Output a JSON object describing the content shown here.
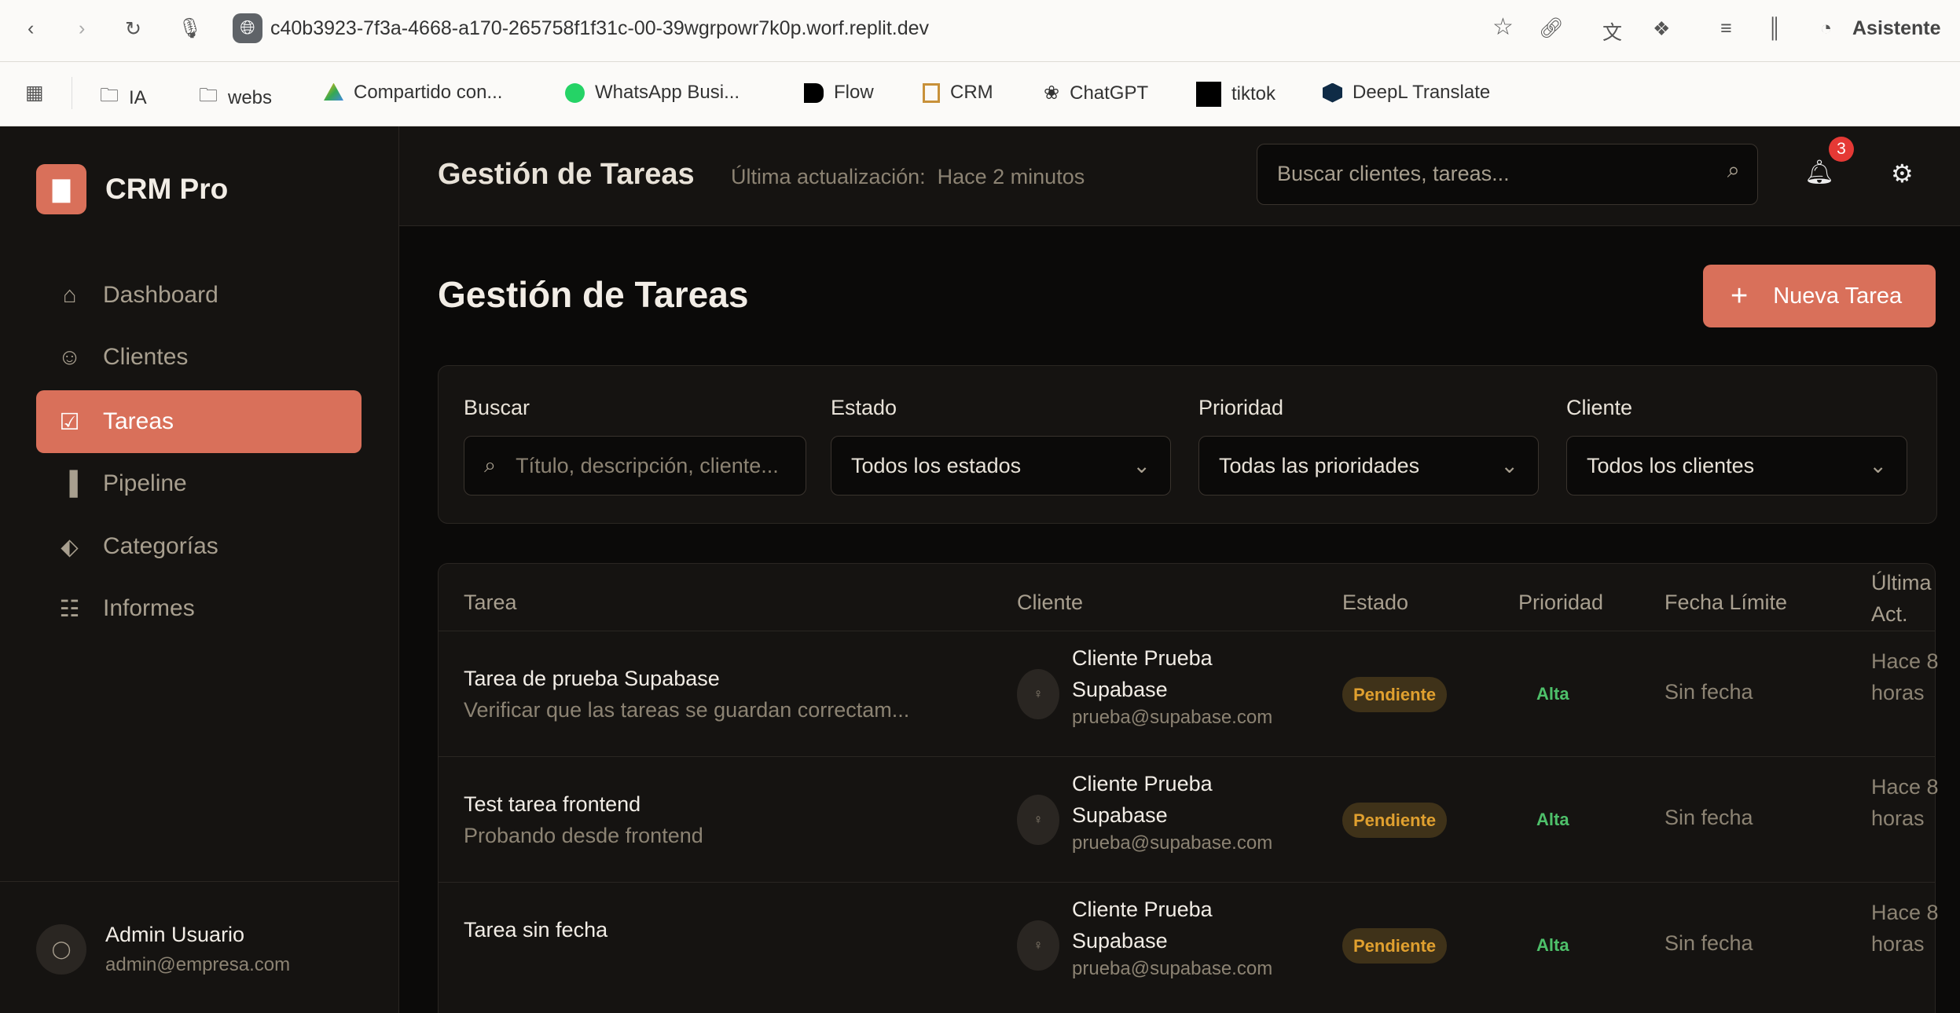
{
  "browser": {
    "url": "c40b3923-7f3a-4668-a170-265758f1f31c-00-39wgrpowr7k0p.worf.replit.dev",
    "assistant_label": "Asistente",
    "bookmarks": [
      {
        "label": "IA",
        "icon": "folder-icon"
      },
      {
        "label": "webs",
        "icon": "folder-icon"
      },
      {
        "label": "Compartido con...",
        "icon": "google-drive-icon"
      },
      {
        "label": "WhatsApp Busi...",
        "icon": "whatsapp-icon"
      },
      {
        "label": "Flow",
        "icon": "flow-icon"
      },
      {
        "label": "CRM",
        "icon": "calendar-icon"
      },
      {
        "label": "ChatGPT",
        "icon": "chatgpt-icon"
      },
      {
        "label": "tiktok",
        "icon": "tiktok-icon"
      },
      {
        "label": "DeepL Translate",
        "icon": "deepl-icon"
      }
    ]
  },
  "sidebar": {
    "brand": "CRM Pro",
    "items": [
      {
        "label": "Dashboard",
        "icon": "home-icon"
      },
      {
        "label": "Clientes",
        "icon": "users-icon"
      },
      {
        "label": "Tareas",
        "icon": "check-square-icon",
        "active": true
      },
      {
        "label": "Pipeline",
        "icon": "bar-chart-icon"
      },
      {
        "label": "Categorías",
        "icon": "tags-icon"
      },
      {
        "label": "Informes",
        "icon": "report-icon"
      }
    ],
    "user": {
      "name": "Admin Usuario",
      "email": "admin@empresa.com"
    }
  },
  "header": {
    "title": "Gestión de Tareas",
    "updated_label": "Última actualización:",
    "updated_value": "Hace 2 minutos",
    "search_placeholder": "Buscar clientes, tareas...",
    "notifications": "3"
  },
  "page": {
    "title": "Gestión de Tareas",
    "new_button": "Nueva Tarea"
  },
  "filters": {
    "search_label": "Buscar",
    "search_placeholder": "Título, descripción, cliente...",
    "estado_label": "Estado",
    "estado_value": "Todos los estados",
    "prioridad_label": "Prioridad",
    "prioridad_value": "Todas las prioridades",
    "cliente_label": "Cliente",
    "cliente_value": "Todos los clientes"
  },
  "table": {
    "headers": [
      "Tarea",
      "Cliente",
      "Estado",
      "Prioridad",
      "Fecha Límite",
      "Última Act."
    ],
    "rows": [
      {
        "title": "Tarea de prueba Supabase",
        "desc": "Verificar que las tareas se guardan correctam...",
        "client": "Cliente Prueba Supabase",
        "email": "prueba@supabase.com",
        "status": "Pendiente",
        "priority": "Alta",
        "due": "Sin fecha",
        "updated": "Hace 8 horas"
      },
      {
        "title": "Test tarea frontend",
        "desc": "Probando desde frontend",
        "client": "Cliente Prueba Supabase",
        "email": "prueba@supabase.com",
        "status": "Pendiente",
        "priority": "Alta",
        "due": "Sin fecha",
        "updated": "Hace 8 horas"
      },
      {
        "title": "Tarea sin fecha",
        "desc": "",
        "client": "Cliente Prueba Supabase",
        "email": "prueba@supabase.com",
        "status": "Pendiente",
        "priority": "Alta",
        "due": "Sin fecha",
        "updated": "Hace 8 horas"
      }
    ]
  },
  "colors": {
    "accent": "#d9705a",
    "status_pending": "#e0a02f",
    "priority_high": "#4ec06a",
    "badge": "#e53935"
  }
}
